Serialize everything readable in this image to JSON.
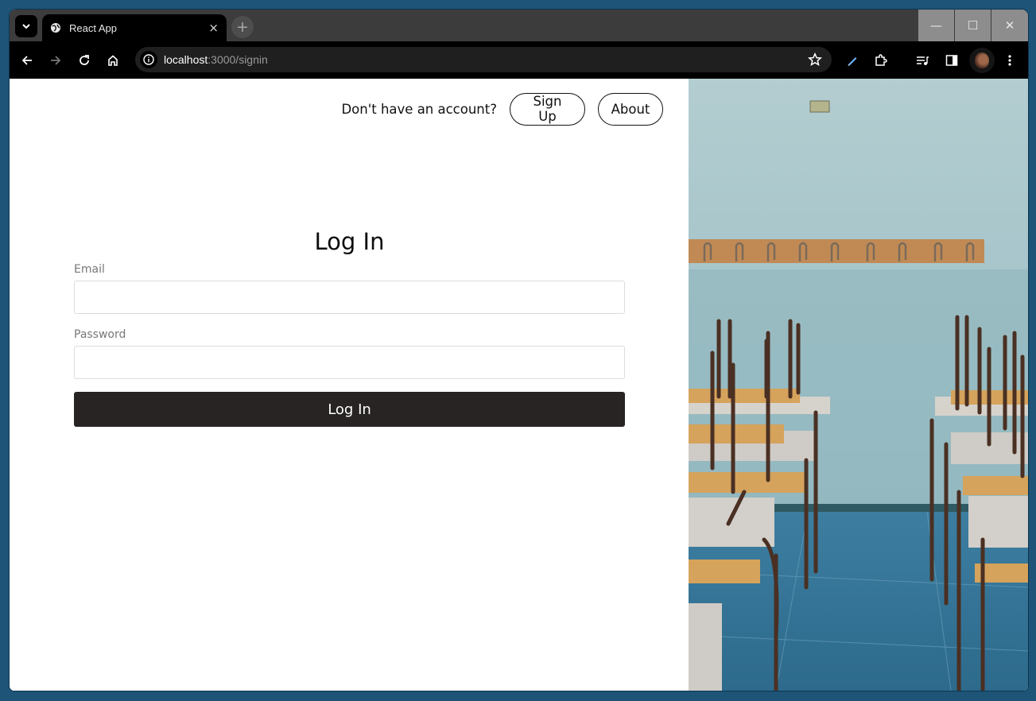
{
  "browser": {
    "tab_title": "React App",
    "tab_close": "×",
    "new_tab": "+",
    "url_host": "localhost",
    "url_path": ":3000/signin",
    "window_controls": {
      "minimize": "—",
      "maximize": "☐",
      "close": "✕"
    }
  },
  "header": {
    "prompt": "Don't have an account?",
    "signup_label": "Sign Up",
    "about_label": "About"
  },
  "form": {
    "title": "Log In",
    "email_label": "Email",
    "password_label": "Password",
    "submit_label": "Log In"
  },
  "hero_image": {
    "subject": "classroom-chairs-photo"
  },
  "colors": {
    "primary_button": "#282424",
    "page_background": "#ffffff",
    "desktop": "#1d5478"
  }
}
